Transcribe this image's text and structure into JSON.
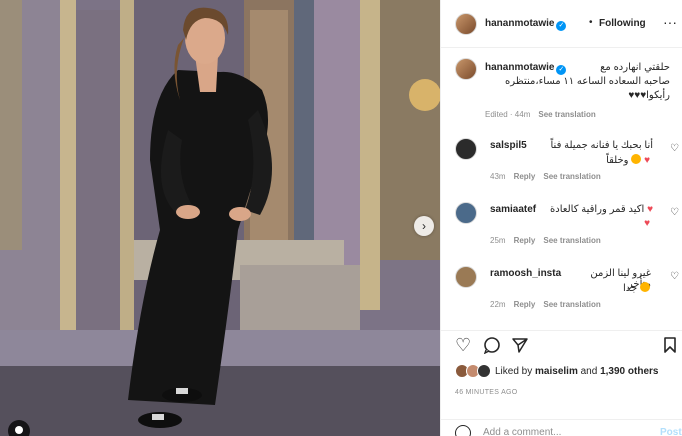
{
  "post": {
    "username": "hananmotawie",
    "follow_label": "Following",
    "dot": "•",
    "more_icon": "more-horizontal-icon",
    "caption_lines": [
      "حلقتي انهارده مع",
      "صاحبه السعاده الساعه ١١ مساء،منتظره",
      "رأيكوا♥♥♥"
    ],
    "edited": "Edited · 44m",
    "see_translation": "See translation"
  },
  "comments": [
    {
      "user": "salspil5",
      "text": "أنا بحبك يا فنانه جميلة فناً",
      "text2": "وخلقاً",
      "time": "43m",
      "reply": "Reply",
      "see_translation": "See translation",
      "avatar_color": "#2b2b2b"
    },
    {
      "user": "samiaatef",
      "text": "اكيد قمر وراقية كالعادة",
      "time": "25m",
      "reply": "Reply",
      "see_translation": "See translation",
      "avatar_color": "#4b6a8a"
    },
    {
      "user": "ramoosh_insta",
      "text": "غيرو لينا الزمن متأخر",
      "text2": "جدا",
      "time": "22m",
      "reply": "Reply",
      "see_translation": "See translation",
      "avatar_color": "#9a7a55"
    }
  ],
  "actions": {
    "like_icon": "heart-outline-icon",
    "comment_icon": "comment-bubble-icon",
    "share_icon": "paper-plane-icon",
    "save_icon": "bookmark-icon"
  },
  "likes": {
    "prefix": "Liked by",
    "user": "maiselim",
    "and": "and",
    "others": "1,390 others"
  },
  "timestamp": "46 MINUTES AGO",
  "add_comment": {
    "placeholder": "Add a comment...",
    "post_label": "Post",
    "emoji_icon": "emoji-smile-icon"
  },
  "colors": {
    "accent": "#0095f6",
    "heart": "#ed4956",
    "muted": "#8e8e8e",
    "post_disabled": "#b2dffc"
  }
}
